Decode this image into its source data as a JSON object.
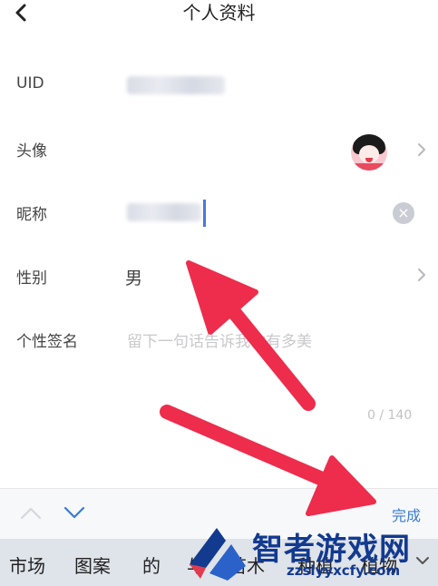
{
  "header": {
    "title": "个人资料",
    "back_icon": "chevron-left-icon"
  },
  "rows": {
    "uid": {
      "label": "UID"
    },
    "avatar": {
      "label": "头像"
    },
    "nickname": {
      "label": "昵称"
    },
    "gender": {
      "label": "性别",
      "value": "男"
    },
    "signature": {
      "label": "个性签名",
      "placeholder": "留下一句话告诉我你有多美",
      "counter": "0 / 140"
    }
  },
  "toolbar": {
    "done_label": "完成"
  },
  "keyboard": {
    "suggestions": [
      "市场",
      "图案",
      "的",
      "与",
      "苗木",
      "种植",
      "植物"
    ]
  },
  "watermark": {
    "title": "智者游戏网",
    "url": "zzslyyxcfy.com"
  },
  "colors": {
    "accent": "#3a7bd5",
    "arrow": "#ee2c4c",
    "watermark": "#123a8f"
  }
}
